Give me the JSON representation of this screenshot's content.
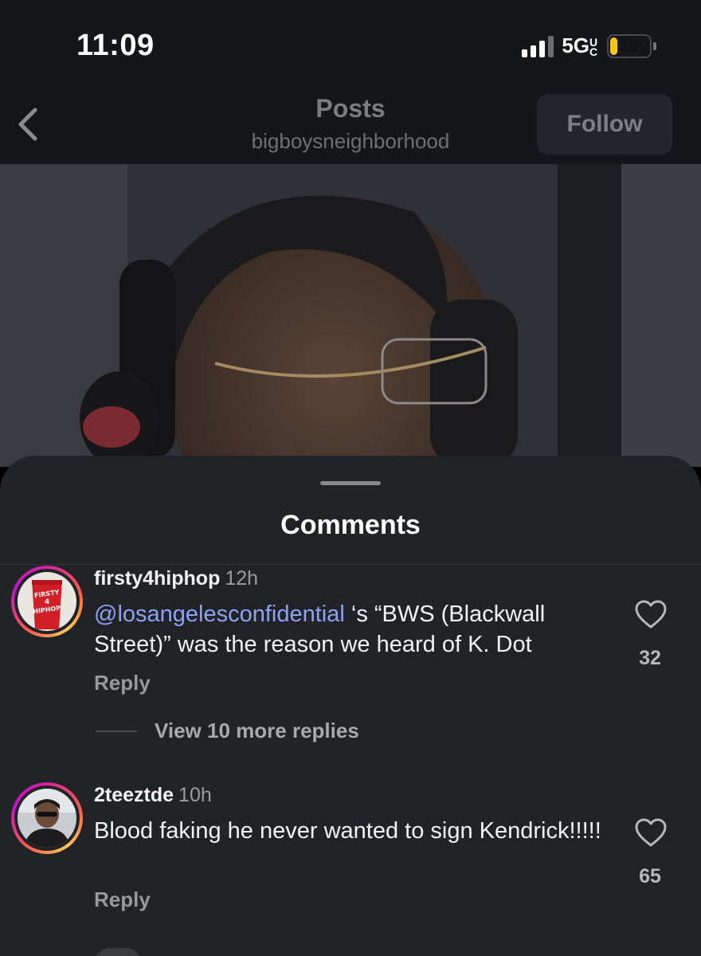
{
  "status_bar": {
    "time": "11:09",
    "network": "5GUC",
    "network_main": "5G",
    "network_sup": "UC",
    "battery": "19",
    "battery_fraction": 0.19
  },
  "header": {
    "title": "Posts",
    "subtitle": "bigboysneighborhood",
    "follow_label": "Follow"
  },
  "comments_sheet": {
    "title": "Comments",
    "comments": [
      {
        "username": "firsty4hiphop",
        "time": "12h",
        "mention": "@losangelesconfidential",
        "text": " ‘s “BWS (Blackwall Street)” was the reason we heard of K. Dot",
        "likes": "32",
        "reply_label": "Reply",
        "view_replies": "View 10 more replies"
      },
      {
        "username": "2teeztde",
        "time": "10h",
        "text": "Blood faking he never wanted to sign Kendrick!!!!!",
        "likes": "65",
        "reply_label": "Reply"
      }
    ]
  },
  "colors": {
    "mention": "#8ea2f5",
    "sheet_bg": "#222327",
    "battery_fill": "#f5c518"
  }
}
